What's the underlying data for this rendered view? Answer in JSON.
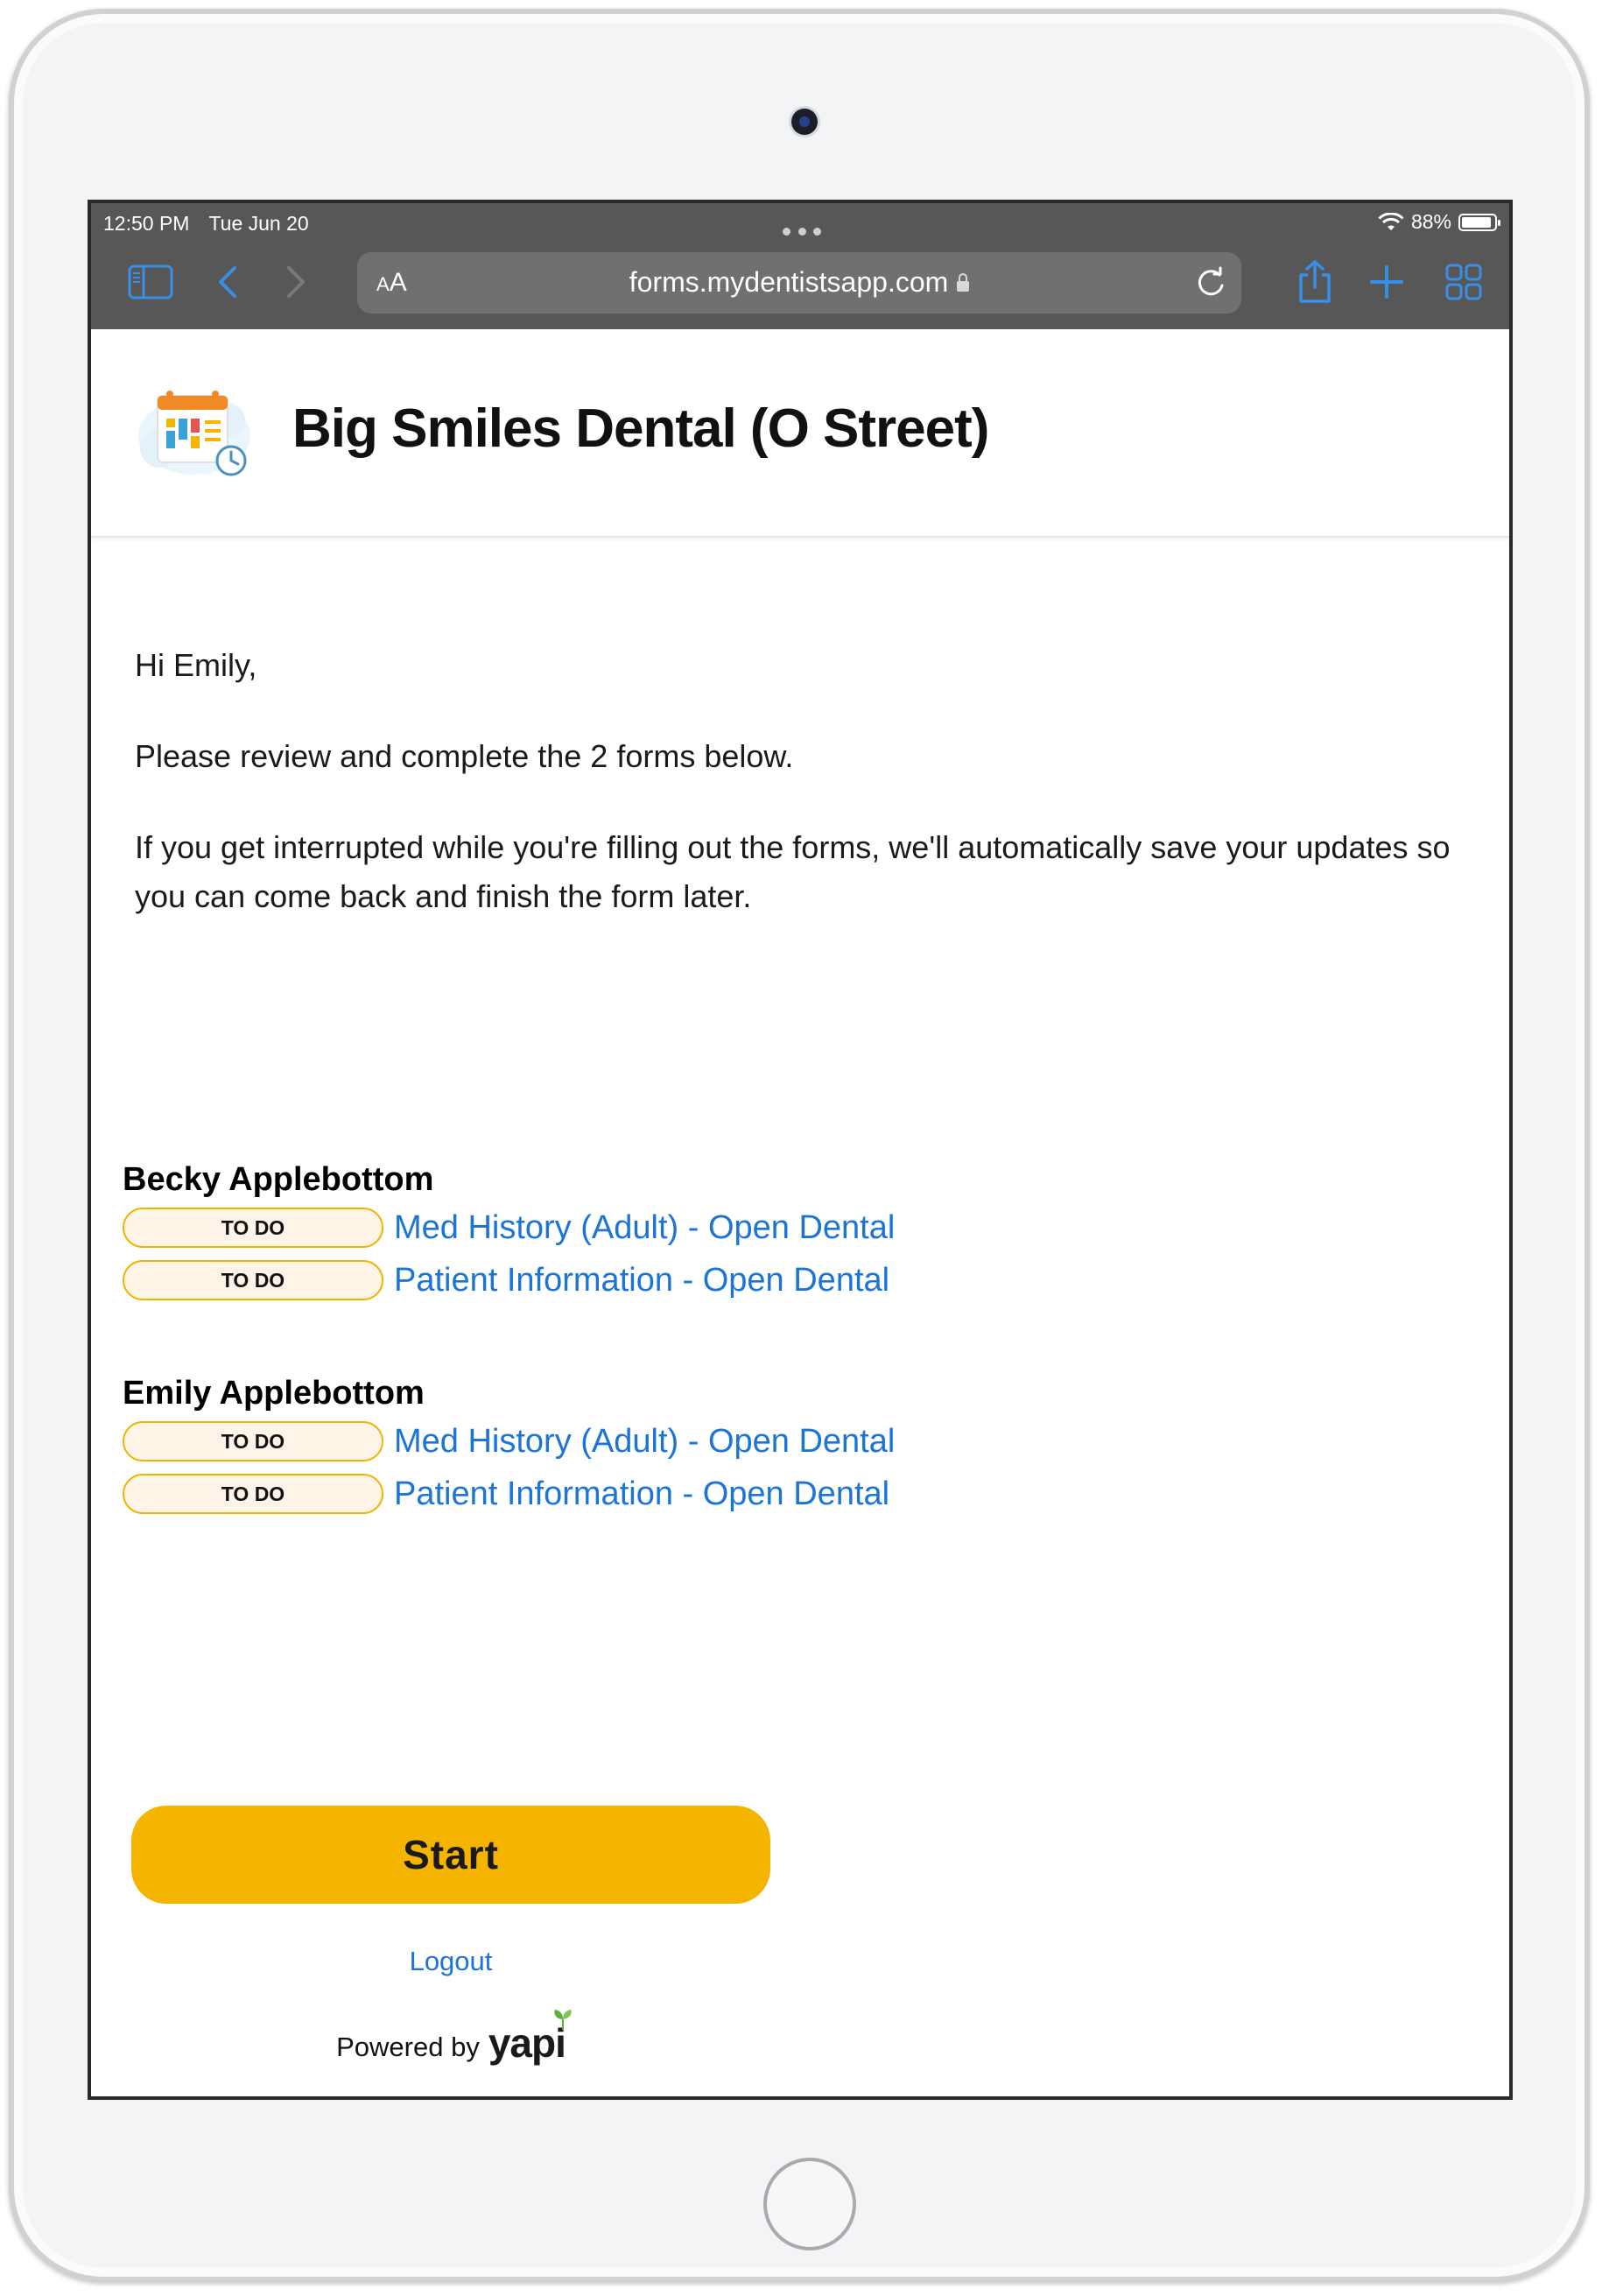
{
  "status_bar": {
    "time": "12:50 PM",
    "date": "Tue Jun 20",
    "battery": "88%"
  },
  "browser": {
    "text_size_label_large": "A",
    "text_size_label_small": "A",
    "url": "forms.mydentistsapp.com",
    "icons": [
      "sidebar-icon",
      "back-icon",
      "forward-icon",
      "lock-icon",
      "reload-icon",
      "share-icon",
      "new-tab-icon",
      "tabs-icon"
    ]
  },
  "header": {
    "clinic_name": "Big Smiles Dental (O Street)"
  },
  "intro": {
    "greeting": "Hi Emily,",
    "instructions": "Please review and complete the 2 forms below.",
    "autosave_note": "If you get interrupted while you're filling out the forms, we'll automatically save your updates so you can come back and finish the form later."
  },
  "patients": [
    {
      "name": "Becky Applebottom",
      "forms": [
        {
          "status": "TO DO",
          "title": "Med History (Adult) - Open Dental"
        },
        {
          "status": "TO DO",
          "title": "Patient Information - Open Dental"
        }
      ]
    },
    {
      "name": "Emily Applebottom",
      "forms": [
        {
          "status": "TO DO",
          "title": "Med History (Adult) - Open Dental"
        },
        {
          "status": "TO DO",
          "title": "Patient Information - Open Dental"
        }
      ]
    }
  ],
  "actions": {
    "start_label": "Start",
    "logout_label": "Logout"
  },
  "footer": {
    "powered_by": "Powered by",
    "brand": "yapi"
  },
  "colors": {
    "accent": "#f5b400",
    "link": "#1b74d6",
    "todo_bg": "#fff4e8",
    "chrome_bg": "#575757",
    "icon_blue": "#3a8ee6"
  }
}
